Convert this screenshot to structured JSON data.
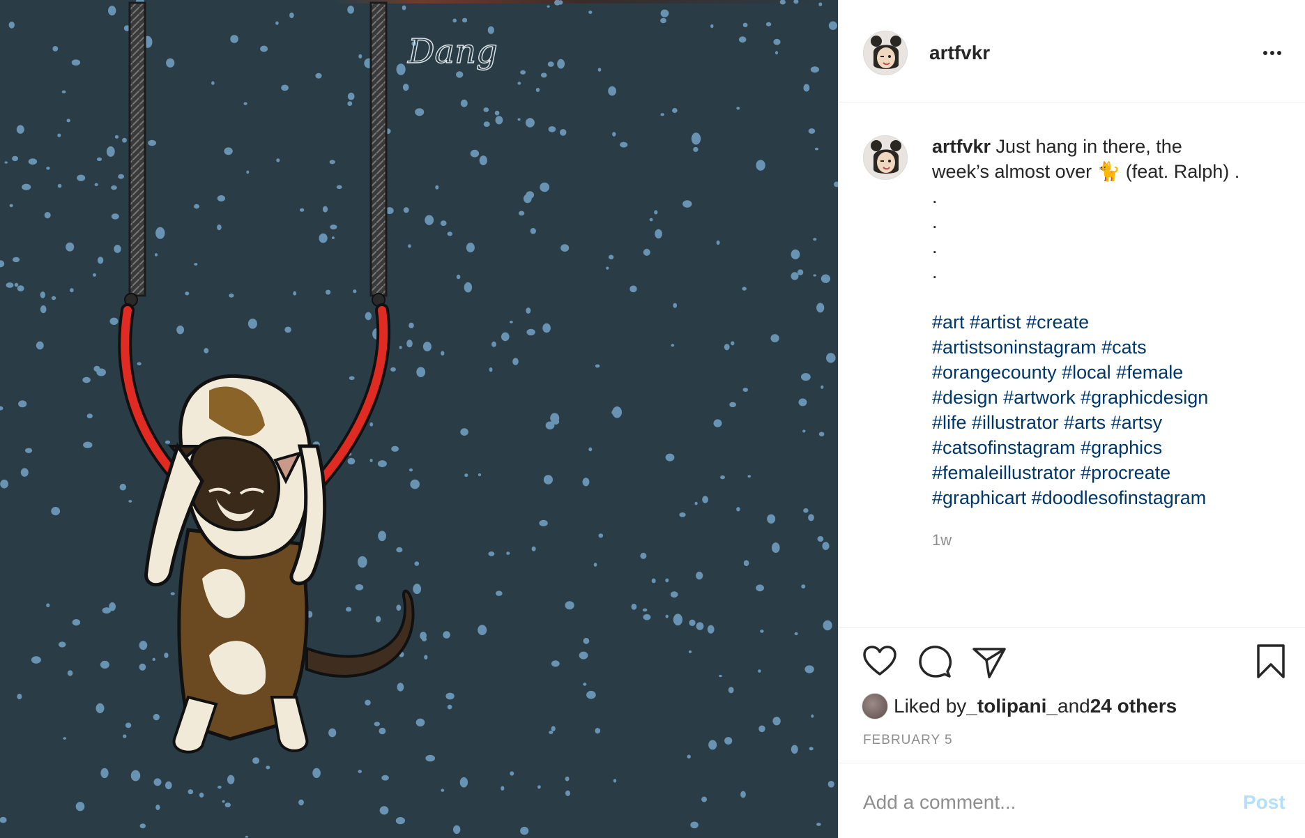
{
  "post": {
    "username": "artfvkr",
    "more_icon": "more-horizontal-icon"
  },
  "caption": {
    "username": "artfvkr",
    "line1": " Just hang in there, the",
    "line2": "week’s almost over 🐈  (feat. Ralph) .",
    "dots": [
      ".",
      ".",
      ".",
      "."
    ],
    "hashtag_lines": [
      "#art #artist #create",
      "#artistsoninstagram #cats",
      "#orangecounty #local #female",
      "#design #artwork #graphicdesign",
      "#life #illustrator #arts #artsy",
      "#catsofinstagram #graphics",
      "#femaleillustrator #procreate",
      "#graphicart #doodlesofinstagram"
    ],
    "time_ago": "1w"
  },
  "image": {
    "signature": "Dang"
  },
  "actions": {
    "icons": [
      "heart-icon",
      "comment-icon",
      "share-icon",
      "bookmark-icon"
    ]
  },
  "likes": {
    "prefix": "Liked by ",
    "user": "_tolipani_",
    "middle": " and ",
    "others": "24 others"
  },
  "date": "FEBRUARY 5",
  "comment": {
    "placeholder": "Add a comment...",
    "post_label": "Post"
  },
  "colors": {
    "background_art": "#2a3d47",
    "hashtag": "#00376b",
    "muted": "#8e8e8e",
    "post_button": "#b2dffc"
  }
}
